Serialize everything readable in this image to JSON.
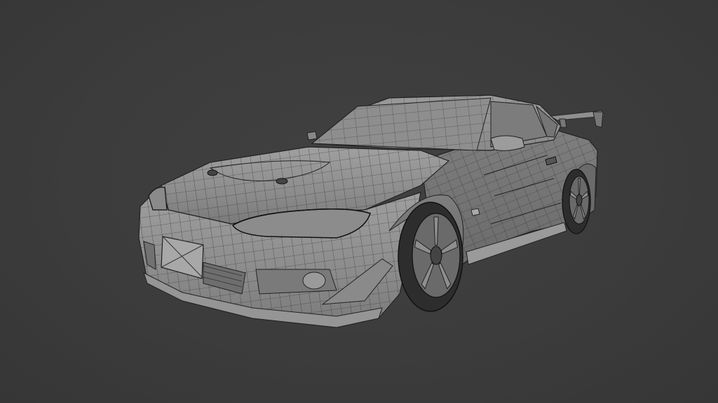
{
  "viewport": {
    "background_color": "#3d3d3d",
    "model_fill_color": "#8a8a8a",
    "wire_color": "#262626"
  },
  "model": {
    "subject": "car-wireframe",
    "wheel_spokes": 5
  }
}
